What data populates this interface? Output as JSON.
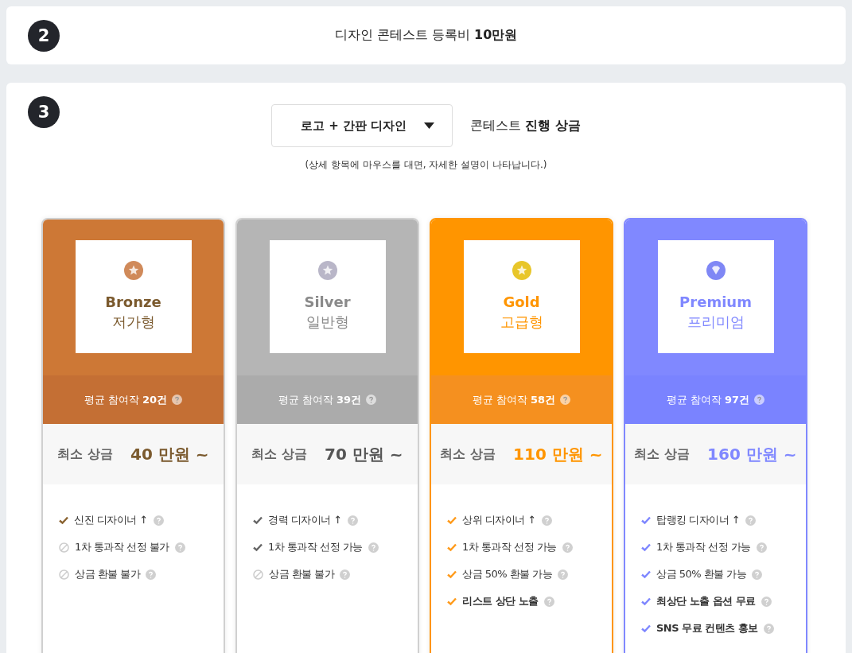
{
  "fee_section": {
    "step": "2",
    "text": "디자인 콘테스트 등록비 **10만원**"
  },
  "prize_section": {
    "step": "3",
    "dropdown": {
      "value": "로고 + 간판 디자인"
    },
    "heading": "콘테스트 **진행 상금**",
    "hint": "(상세 항목에 마우스를 대면, 자세한 설명이 나타납니다.)",
    "plans": [
      {
        "kind": "bronze",
        "name": "Bronze",
        "subtitle": "저가형",
        "average": "평균 참여작 **20건**",
        "prize_label": "최소 상금",
        "prize": "40 만원 ~",
        "features": [
          {
            "kind": "check",
            "text": "신진 디자이너 ↑",
            "bold": false
          },
          {
            "kind": "none",
            "text": "1차 통과작 선정 불가",
            "bold": false
          },
          {
            "kind": "none",
            "text": "상금 환불 불가",
            "bold": false
          }
        ]
      },
      {
        "kind": "silver",
        "name": "Silver",
        "subtitle": "일반형",
        "average": "평균 참여작 **39건**",
        "prize_label": "최소 상금",
        "prize": "70 만원 ~",
        "features": [
          {
            "kind": "check",
            "text": "경력 디자이너 ↑",
            "bold": false
          },
          {
            "kind": "check",
            "text": "1차 통과작 선정 가능",
            "bold": false
          },
          {
            "kind": "none",
            "text": "상금 환불 불가",
            "bold": false
          }
        ]
      },
      {
        "kind": "gold",
        "name": "Gold",
        "subtitle": "고급형",
        "average": "평균 참여작 **58건**",
        "prize_label": "최소 상금",
        "prize": "110 만원 ~",
        "features": [
          {
            "kind": "check",
            "text": "상위 디자이너 ↑",
            "bold": false
          },
          {
            "kind": "check",
            "text": "1차 통과작 선정 가능",
            "bold": false
          },
          {
            "kind": "check",
            "text": "상금 50% 환불 가능",
            "bold": false
          },
          {
            "kind": "check",
            "text": "리스트 상단 노출",
            "bold": true
          }
        ]
      },
      {
        "kind": "premium",
        "name": "Premium",
        "subtitle": "프리미엄",
        "average": "평균 참여작 **97건**",
        "prize_label": "최소 상금",
        "prize": "160 만원 ~",
        "features": [
          {
            "kind": "check",
            "text": "탑랭킹 디자이너 ↑",
            "bold": false
          },
          {
            "kind": "check",
            "text": "1차 통과작 선정 가능",
            "bold": false
          },
          {
            "kind": "check",
            "text": "상금 50% 환불 가능",
            "bold": false
          },
          {
            "kind": "check",
            "text": "최상단 노출 옵션 무료",
            "bold": true
          },
          {
            "kind": "check",
            "text": "SNS 무료 컨텐츠 홍보",
            "bold": true
          }
        ]
      }
    ]
  }
}
